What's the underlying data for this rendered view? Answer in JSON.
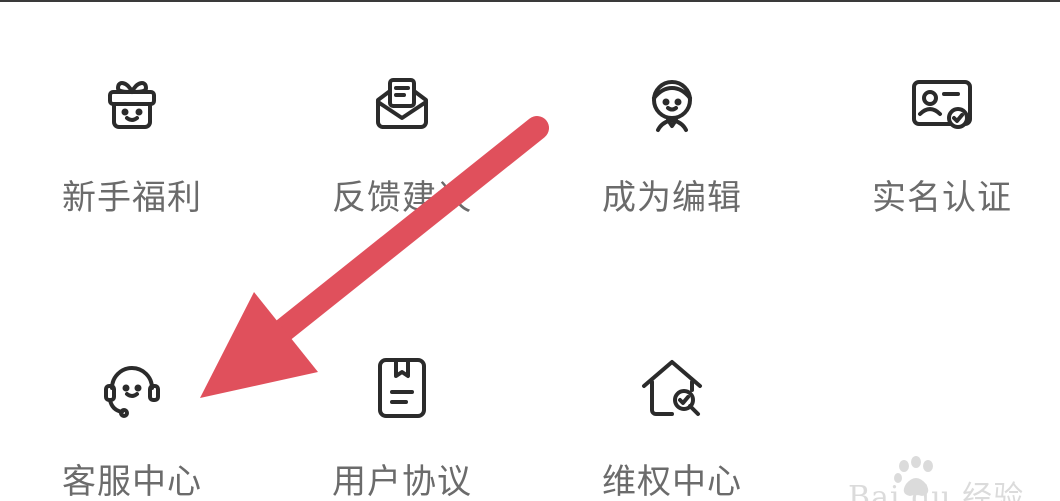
{
  "menu": {
    "row1": [
      {
        "label": "新手福利",
        "icon": "gift-smile-icon"
      },
      {
        "label": "反馈建议",
        "icon": "feedback-envelope-icon"
      },
      {
        "label": "成为编辑",
        "icon": "editor-person-icon"
      },
      {
        "label": "实名认证",
        "icon": "id-card-verified-icon"
      }
    ],
    "row2": [
      {
        "label": "客服中心",
        "icon": "customer-service-headset-icon"
      },
      {
        "label": "用户协议",
        "icon": "agreement-document-icon"
      },
      {
        "label": "维权中心",
        "icon": "rights-protection-house-icon"
      }
    ]
  },
  "annotation": {
    "arrow_color": "#e0505c"
  },
  "watermark": {
    "text": "Bai du 经验"
  },
  "colors": {
    "label": "#6b6b6b",
    "icon_stroke": "#2b2b2b",
    "background": "#ffffff"
  }
}
